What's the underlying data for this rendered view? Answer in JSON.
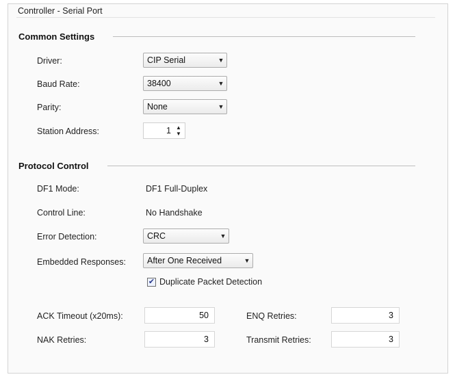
{
  "panel": {
    "title": "Controller - Serial Port"
  },
  "common": {
    "heading": "Common Settings",
    "driver_label": "Driver:",
    "driver_value": "CIP Serial",
    "baud_label": "Baud Rate:",
    "baud_value": "38400",
    "parity_label": "Parity:",
    "parity_value": "None",
    "station_label": "Station Address:",
    "station_value": "1"
  },
  "protocol": {
    "heading": "Protocol Control",
    "df1_label": "DF1 Mode:",
    "df1_value": "DF1 Full-Duplex",
    "control_label": "Control Line:",
    "control_value": "No Handshake",
    "error_label": "Error Detection:",
    "error_value": "CRC",
    "embedded_label": "Embedded Responses:",
    "embedded_value": "After One Received",
    "dup_label": "Duplicate Packet Detection",
    "dup_checked": true,
    "ack_label": "ACK Timeout (x20ms):",
    "ack_value": "50",
    "nak_label": "NAK Retries:",
    "nak_value": "3",
    "enq_label": "ENQ Retries:",
    "enq_value": "3",
    "transmit_label": "Transmit Retries:",
    "transmit_value": "3"
  },
  "icons": {
    "dropdown": "chevron-down-icon",
    "spin_up": "spin-up-icon",
    "spin_down": "spin-down-icon",
    "check": "checkmark-icon"
  }
}
